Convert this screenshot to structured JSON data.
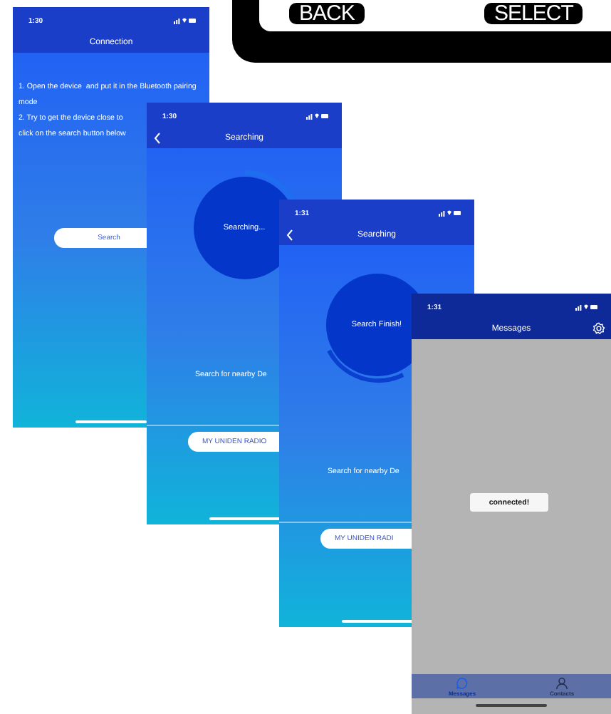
{
  "device_display": {
    "buttons": [
      "BACK",
      "SELECT"
    ]
  },
  "screens": [
    {
      "kind": "connection",
      "time": "1:30",
      "title": "Connection",
      "back": false,
      "instructions": [
        "1. Open the device  and put it in the Bluetooth pairing mode",
        "2. Try to get the device close to",
        "click on the search button below"
      ],
      "button": "Search"
    },
    {
      "kind": "searching",
      "time": "1:30",
      "title": "Searching",
      "back": true,
      "finished": false,
      "status": "Searching...",
      "caption": "Search for nearby De",
      "button": "MY UNIDEN RADIO"
    },
    {
      "kind": "searching",
      "time": "1:31",
      "title": "Searching",
      "back": true,
      "finished": true,
      "status": "Search Finish!",
      "caption": "Search for nearby De",
      "button": "MY UNIDEN RADI"
    },
    {
      "kind": "messages",
      "time": "1:31",
      "title": "Messages",
      "toast": "connected!",
      "tabs": [
        {
          "label": "Messages",
          "selected": true
        },
        {
          "label": "Contacts",
          "selected": false
        }
      ]
    }
  ]
}
